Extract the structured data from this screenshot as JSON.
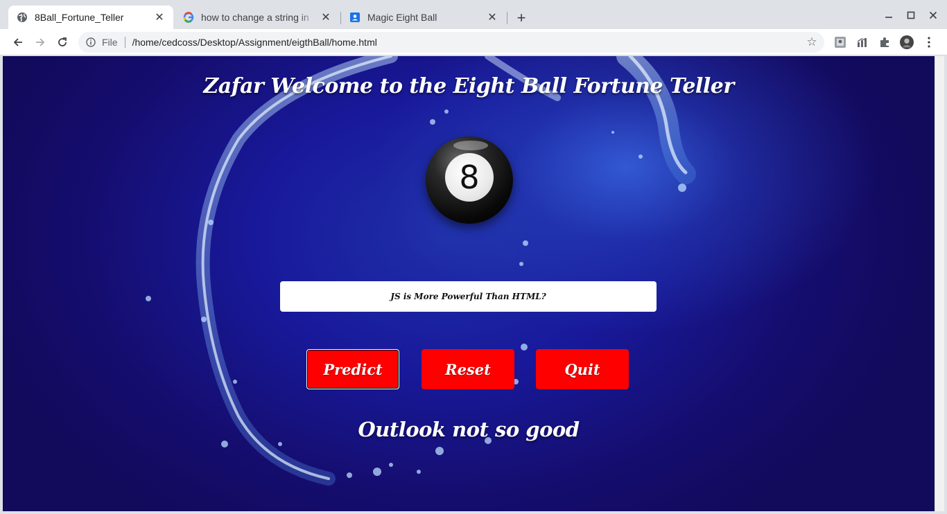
{
  "browser": {
    "tabs": [
      {
        "title": "8Ball_Fortune_Teller",
        "icon": "globe-icon",
        "active": true
      },
      {
        "title": "how to change a string in",
        "icon": "google-icon",
        "active": false
      },
      {
        "title": "Magic Eight Ball",
        "icon": "contact-icon",
        "active": false
      }
    ],
    "omnibox": {
      "scheme": "File",
      "url": "/home/cedcoss/Desktop/Assignment/eigthBall/home.html"
    }
  },
  "page": {
    "title": "Zafar Welcome to the Eight Ball Fortune Teller",
    "ball_number": "8",
    "question": {
      "value": "JS is More Powerful Than HTML?"
    },
    "buttons": {
      "predict": "Predict",
      "reset": "Reset",
      "quit": "Quit"
    },
    "answer": "Outlook not so good"
  },
  "colors": {
    "background": "#150d6e",
    "button": "#ff0000",
    "text": "#ffffff"
  }
}
